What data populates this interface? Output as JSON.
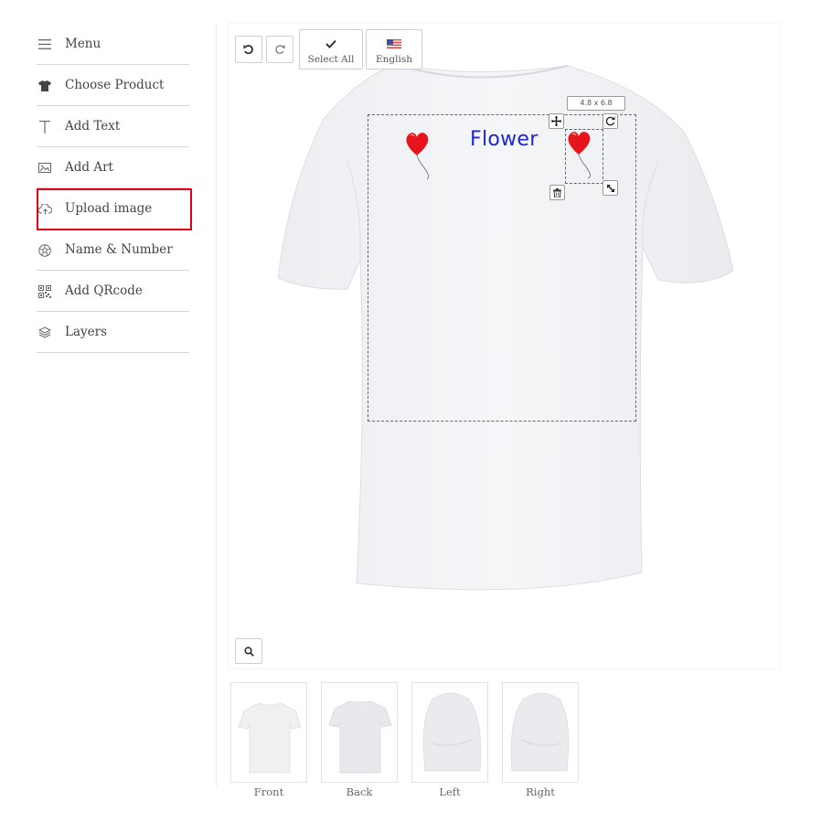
{
  "sidebar": {
    "items": [
      {
        "label": "Menu",
        "icon": "menu-icon"
      },
      {
        "label": "Choose Product",
        "icon": "tshirt-icon"
      },
      {
        "label": "Add Text",
        "icon": "text-icon"
      },
      {
        "label": "Add Art",
        "icon": "image-icon"
      },
      {
        "label": "Upload image",
        "icon": "cloud-upload-icon"
      },
      {
        "label": "Name & Number",
        "icon": "soccer-ball-icon"
      },
      {
        "label": "Add QRcode",
        "icon": "qrcode-icon"
      },
      {
        "label": "Layers",
        "icon": "layers-icon"
      }
    ],
    "highlighted": "Upload image",
    "highlight_color": "#e0001b"
  },
  "toolbar": {
    "select_all_label": "Select All",
    "language_label": "English"
  },
  "design": {
    "text": "Flower",
    "text_color": "#1f24d4",
    "size_label": "4.8 x 6.8"
  },
  "views": [
    {
      "label": "Front"
    },
    {
      "label": "Back"
    },
    {
      "label": "Left"
    },
    {
      "label": "Right"
    }
  ]
}
